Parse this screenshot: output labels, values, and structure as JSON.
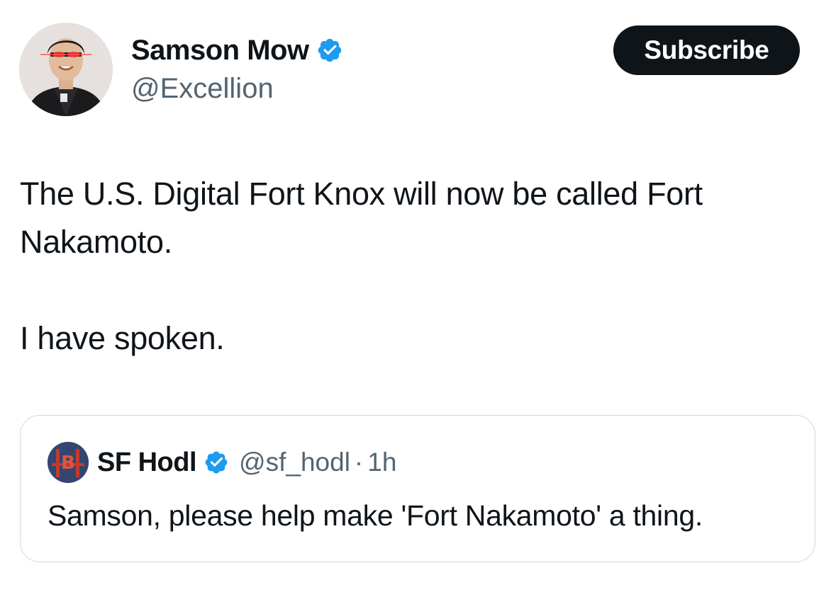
{
  "author": {
    "display_name": "Samson Mow",
    "handle": "@Excellion",
    "verified_icon": "verified-badge-icon"
  },
  "actions": {
    "subscribe_label": "Subscribe"
  },
  "tweet": {
    "line1": "The U.S. Digital Fort Knox will now be called Fort",
    "line2": "Nakamoto.",
    "line3": "I have spoken."
  },
  "quoted_tweet": {
    "display_name": "SF Hodl",
    "handle": "@sf_hodl",
    "separator": "·",
    "time": "1h",
    "text": "Samson, please help make 'Fort Nakamoto' a thing."
  },
  "colors": {
    "verified_blue": "#1d9bf0",
    "secondary_text": "#536471",
    "primary_text": "#0f1419",
    "border": "#cfd9de"
  }
}
